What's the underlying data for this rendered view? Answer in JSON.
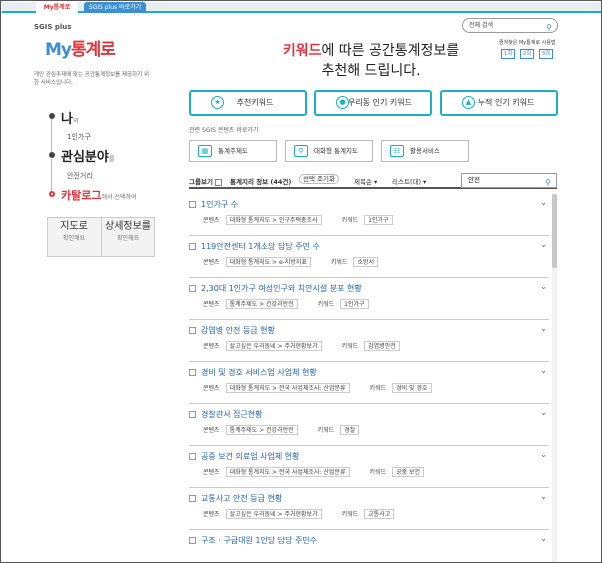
{
  "tabs": [
    {
      "label": "My통계로"
    },
    {
      "label": "SGIS plus 바로가기"
    }
  ],
  "sidebar": {
    "logo_small": "SGIS plus",
    "logo_my": "My",
    "logo_main": "통계로",
    "description": "개인 관심주제에 맞는 공간통계정보를 제공하기 위한 서비스입니다.",
    "nav": [
      {
        "label": "나",
        "suffix": "의",
        "sub": "1인가구"
      },
      {
        "label": "관심분야",
        "suffix": "를",
        "sub": "안전거리"
      },
      {
        "label": "카탈로그",
        "suffix": "에서 선택하여"
      }
    ],
    "box_left_title": "지도로",
    "box_left_sub": "확인해요",
    "box_right_title": "상세정보를",
    "box_right_sub": "확인해요"
  },
  "top_search": {
    "placeholder": "전체 검색"
  },
  "ranking": {
    "label": "즐겨찾은 My통계로 사용법",
    "buttons": [
      "1회",
      "2회",
      "3회"
    ]
  },
  "headline": {
    "keyword": "키워드",
    "line1_rest": "에 따른 공간통계정보를",
    "line2": "추천해 드립니다."
  },
  "main_buttons": [
    "추천키워드",
    "우리동 인기 키워드",
    "누적 인기 키워드"
  ],
  "related": {
    "label": "관련 SGIS 콘텐츠 바로가기",
    "buttons": [
      "통계주제도",
      "대화형 통계지도",
      "활용서비스"
    ]
  },
  "toolbar": {
    "group_label": "그룹보기",
    "count_label": "통계지리 정보 (44건)",
    "view_all": "선택 조기화",
    "sort": "제목순 ▾",
    "view": "리스트(대) ▾",
    "search_value": "안전"
  },
  "list_labels": {
    "content": "콘텐츠",
    "keyword": "키워드"
  },
  "items": [
    {
      "title": "1인가구 수",
      "content": "대화형 통계지도 > 인구주택총조사",
      "keyword": "1인가구"
    },
    {
      "title": "119안전센터 1개소당 담당 주민 수",
      "content": "대화형 통계지도 > e-지방지표",
      "keyword": "소방서"
    },
    {
      "title": "2,30대 1인가구 여성인구와 치안시설 분포 현황",
      "content": "통계주제도 > 건강과안전",
      "keyword": "1인가구"
    },
    {
      "title": "감염병 안전 등급 현황",
      "content": "살고싶은 우리동네 > 주거현황보기",
      "keyword": "감염병안전"
    },
    {
      "title": "경비 및 경호 서비스업 사업체 현황",
      "content": "대화형 통계지도 > 전국 사업체조사: 산업분류",
      "keyword": "경비 및 경호"
    },
    {
      "title": "경찰관서 접근현황",
      "content": "통계주제도 > 건강과안전",
      "keyword": "경찰"
    },
    {
      "title": "공중 보건 의료업 사업체 현황",
      "content": "대화형 통계지도 > 전국 사업체조사: 산업분류",
      "keyword": "공중 보건"
    },
    {
      "title": "교통사고 안전 등급 현황",
      "content": "살고싶은 우리동네 > 주거현황보기",
      "keyword": "교통사고"
    },
    {
      "title": "구조 · 구급대원 1인당 담당 주민수",
      "content": "",
      "keyword": ""
    }
  ]
}
